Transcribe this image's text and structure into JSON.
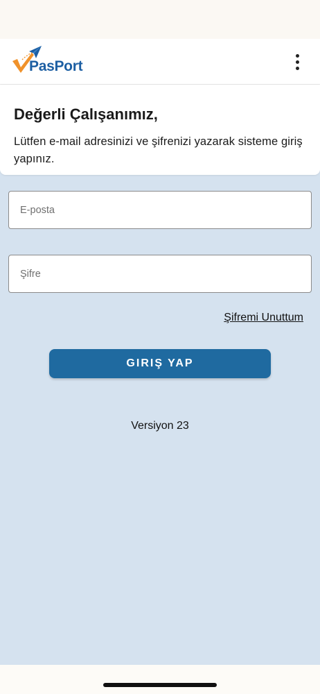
{
  "header": {
    "logo_text": "PasPort"
  },
  "welcome": {
    "title": "Değerli Çalışanımız,",
    "message": "Lütfen e-mail adresinizi ve şifrenizi yazarak sisteme giriş yapınız."
  },
  "form": {
    "email_placeholder": "E-posta",
    "email_value": "",
    "password_placeholder": "Şifre",
    "password_value": "",
    "forgot_password_label": "Şifremi Unuttum",
    "login_button_label": "GIRIŞ YAP"
  },
  "footer": {
    "version_text": "Versiyon 23"
  },
  "colors": {
    "brand_blue": "#1d5fa3",
    "brand_orange": "#f0922b",
    "button_blue": "#1f6aa0",
    "content_background": "#d5e2ef"
  },
  "icons": {
    "logo": "paper-plane-check-icon",
    "menu": "more-vertical-icon"
  }
}
